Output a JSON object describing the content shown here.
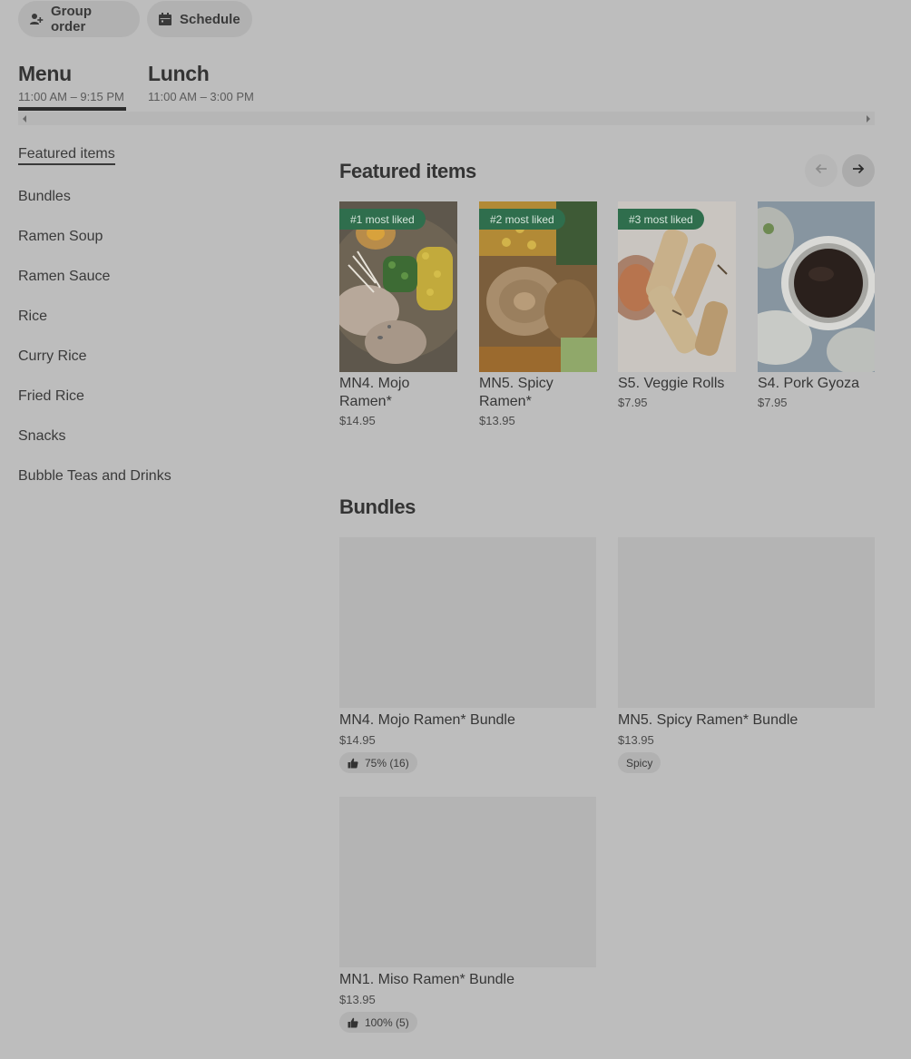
{
  "top_actions": {
    "group_order": "Group order",
    "schedule": "Schedule"
  },
  "menus": [
    {
      "title": "Menu",
      "hours": "11:00 AM – 9:15 PM",
      "selected": true
    },
    {
      "title": "Lunch",
      "hours": "11:00 AM – 3:00 PM",
      "selected": false
    }
  ],
  "sidebar": {
    "items": [
      {
        "label": "Featured items",
        "active": true
      },
      {
        "label": "Bundles"
      },
      {
        "label": "Ramen Soup"
      },
      {
        "label": "Ramen Sauce"
      },
      {
        "label": "Rice"
      },
      {
        "label": "Curry Rice"
      },
      {
        "label": "Fried Rice"
      },
      {
        "label": "Snacks"
      },
      {
        "label": "Bubble Teas and Drinks"
      }
    ]
  },
  "featured": {
    "title": "Featured items",
    "items": [
      {
        "badge": "#1 most liked",
        "name": "MN4. Mojo Ramen*",
        "price": "$14.95"
      },
      {
        "badge": "#2 most liked",
        "name": "MN5. Spicy Ramen*",
        "price": "$13.95"
      },
      {
        "badge": "#3 most liked",
        "name": "S5. Veggie Rolls",
        "price": "$7.95"
      },
      {
        "badge": "",
        "name": "S4. Pork Gyoza",
        "price": "$7.95"
      }
    ]
  },
  "bundles": {
    "title": "Bundles",
    "items": [
      {
        "name": "MN4. Mojo Ramen* Bundle",
        "price": "$14.95",
        "rating": "75% (16)"
      },
      {
        "name": "MN5. Spicy Ramen* Bundle",
        "price": "$13.95",
        "tag": "Spicy"
      },
      {
        "name": "MN1. Miso Ramen* Bundle",
        "price": "$13.95",
        "rating": "100% (5)"
      }
    ]
  },
  "colors": {
    "background": "#bdbdbd",
    "badge": "#2f6e4d",
    "text": "#3b3b3b"
  }
}
